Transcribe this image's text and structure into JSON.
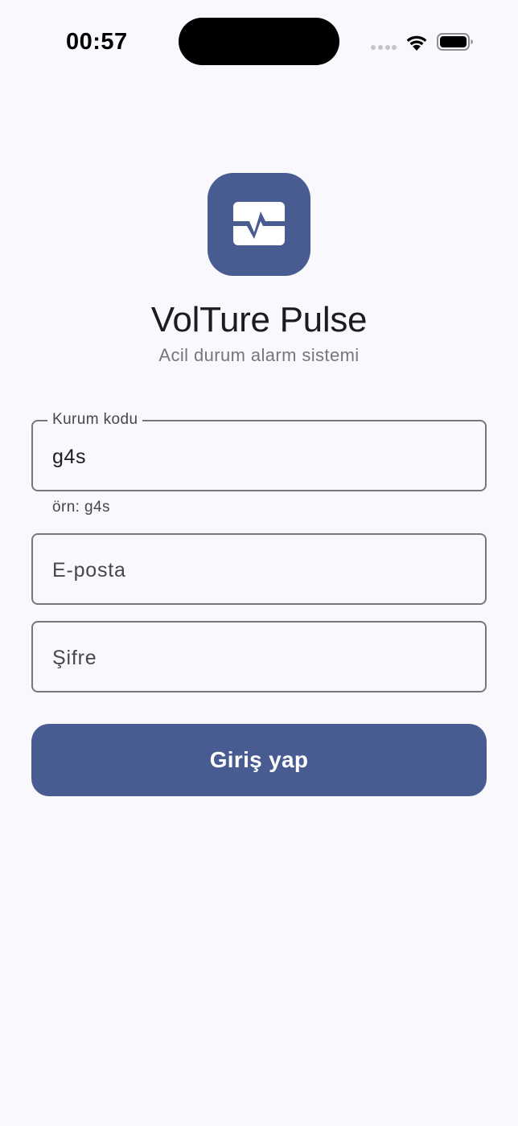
{
  "status_bar": {
    "time": "00:57",
    "icons": [
      "cellular-signal-icon",
      "wifi-icon",
      "battery-icon"
    ]
  },
  "app": {
    "logo_icon": "pulse-monitor-icon",
    "title": "VolTure Pulse",
    "subtitle": "Acil durum alarm sistemi"
  },
  "form": {
    "org_code": {
      "label": "Kurum kodu",
      "value": "g4s",
      "helper": "örn: g4s"
    },
    "email": {
      "placeholder": "E-posta",
      "value": ""
    },
    "password": {
      "placeholder": "Şifre",
      "value": ""
    },
    "submit_label": "Giriş yap"
  },
  "colors": {
    "primary": "#485c91",
    "background": "#f9f8fd",
    "outline": "#75767f",
    "on_surface": "#1b1b21",
    "on_surface_variant": "#45464f"
  }
}
